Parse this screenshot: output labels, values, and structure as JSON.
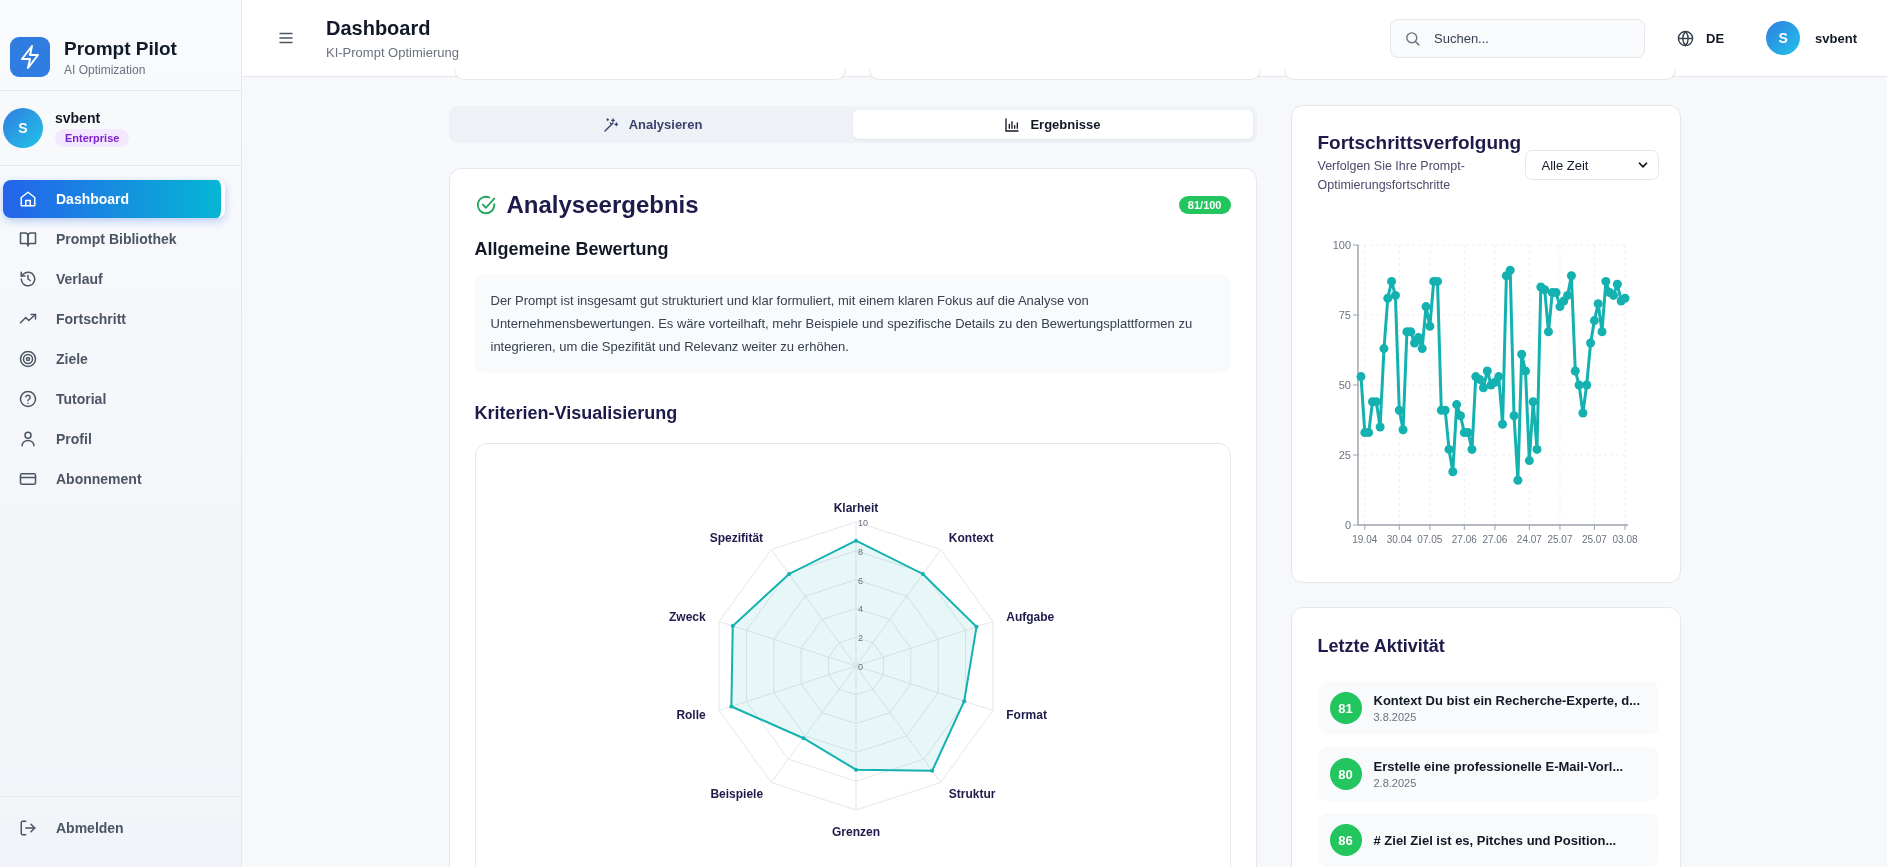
{
  "sidebar": {
    "brand": {
      "title": "Prompt Pilot",
      "subtitle": "AI Optimization"
    },
    "user": {
      "avatar": "S",
      "name": "svbent",
      "plan": "Enterprise"
    },
    "nav": [
      {
        "label": "Dashboard",
        "selected": true
      },
      {
        "label": "Prompt Bibliothek",
        "selected": false
      },
      {
        "label": "Verlauf",
        "selected": false
      },
      {
        "label": "Fortschritt",
        "selected": false
      },
      {
        "label": "Ziele",
        "selected": false
      },
      {
        "label": "Tutorial",
        "selected": false
      },
      {
        "label": "Profil",
        "selected": false
      },
      {
        "label": "Abonnement",
        "selected": false
      }
    ],
    "logout": "Abmelden"
  },
  "header": {
    "title": "Dashboard",
    "subtitle": "KI-Prompt Optimierung",
    "search": {
      "placeholder": "Suchen..."
    },
    "language": "DE",
    "user": {
      "avatar": "S",
      "name": "svbent"
    }
  },
  "tabs": [
    {
      "label": "Analysieren",
      "selected": false
    },
    {
      "label": "Ergebnisse",
      "selected": true
    }
  ],
  "analysis": {
    "title": "Analyseergebnis",
    "score": "81/100",
    "overall_heading": "Allgemeine Bewertung",
    "overall_text": "Der Prompt ist insgesamt gut strukturiert und klar formuliert, mit einem klaren Fokus auf die Analyse von Unternehmensbewertungen. Es wäre vorteilhaft, mehr Beispiele und spezifische Details zu den Bewertungsplattformen zu integrieren, um die Spezifität und Relevanz weiter zu erhöhen.",
    "criteria_heading": "Kriterien-Visualisierung",
    "chart_data": {
      "type": "radar",
      "categories": [
        "Klarheit",
        "Kontext",
        "Aufgabe",
        "Format",
        "Struktur",
        "Grenzen",
        "Beispiele",
        "Rolle",
        "Zweck",
        "Spezifität"
      ],
      "series": [
        {
          "color": "#14b1b1",
          "values": [
            8.7,
            7.9,
            8.8,
            7.9,
            9.0,
            7.2,
            6.2,
            9.1,
            9.0,
            7.9
          ]
        }
      ],
      "ylim": [
        0,
        10
      ],
      "yticks": [
        0,
        2,
        4,
        6,
        8,
        10
      ]
    }
  },
  "progress": {
    "title": "Fortschrittsverfolgung",
    "subtitle": "Verfolgen Sie Ihre Prompt-Optimierungsfortschritte",
    "range": "Alle Zeit",
    "chart_data": {
      "type": "line",
      "grid": true,
      "categories": [
        null,
        "19.04",
        null,
        null,
        null,
        null,
        null,
        null,
        null,
        null,
        "30.04",
        null,
        null,
        null,
        null,
        null,
        null,
        null,
        "07.05",
        null,
        null,
        null,
        null,
        null,
        null,
        null,
        null,
        "27.06",
        null,
        null,
        null,
        null,
        null,
        null,
        null,
        "27.06",
        null,
        null,
        null,
        null,
        null,
        null,
        null,
        null,
        "24.07",
        null,
        null,
        null,
        null,
        null,
        null,
        null,
        "25.07",
        null,
        null,
        null,
        null,
        null,
        null,
        null,
        null,
        "25.07",
        null,
        null,
        null,
        null,
        null,
        null,
        null,
        "03.08"
      ],
      "series": [
        {
          "color": "#14b1b1",
          "marker": "circle",
          "values": [
            53,
            33,
            33,
            44,
            44,
            35,
            63,
            81,
            87,
            82,
            41,
            34,
            69,
            69,
            65,
            67,
            63,
            78,
            71,
            87,
            87,
            41,
            41,
            27,
            19,
            43,
            39,
            33,
            33,
            27,
            53,
            52,
            49,
            55,
            50,
            51,
            53,
            36,
            89,
            91,
            39,
            16,
            61,
            55,
            23,
            44,
            27,
            85,
            84,
            69,
            83,
            83,
            78,
            80,
            82,
            89,
            55,
            50,
            40,
            50,
            65,
            73,
            79,
            69,
            87,
            83,
            82,
            86,
            80,
            81
          ]
        }
      ],
      "ylim": [
        0,
        100
      ],
      "yticks": [
        0,
        25,
        50,
        75,
        100
      ]
    }
  },
  "activity": {
    "title": "Letzte Aktivität",
    "items": [
      {
        "score": "81",
        "title": "Kontext Du bist ein Recherche-Experte, d...",
        "date": "3.8.2025"
      },
      {
        "score": "80",
        "title": "Erstelle eine professionelle E-Mail-Vorl...",
        "date": "2.8.2025"
      },
      {
        "score": "86",
        "title": "# Ziel Ziel ist es, Pitches und Position..."
      }
    ]
  }
}
